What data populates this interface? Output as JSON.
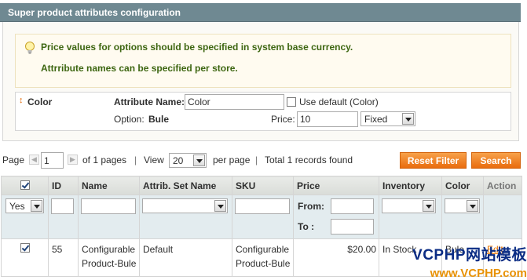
{
  "section": {
    "title": "Super product attributes configuration"
  },
  "notice": {
    "line1": "Price values for options should be specified in system base currency.",
    "line2": "Attrribute names can be specified per store."
  },
  "attribute": {
    "title": "Color",
    "name_label": "Attribute Name:",
    "name_value": "Color",
    "use_default_label": "Use default (Color)",
    "use_default_checked": false,
    "option_label": "Option:",
    "option_value": "Bule",
    "price_label": "Price:",
    "price_value": "10",
    "price_type": "Fixed"
  },
  "pager": {
    "page_label": "Page",
    "page_value": "1",
    "of_pages": "of 1 pages",
    "view_label": "View",
    "per_page_value": "20",
    "per_page_label": "per page",
    "records": "Total 1 records found",
    "reset_filter": "Reset Filter",
    "search": "Search"
  },
  "grid": {
    "headings": [
      "",
      "ID",
      "Name",
      "Attrib. Set Name",
      "SKU",
      "Price",
      "Inventory",
      "Color",
      "Action"
    ],
    "filter": {
      "selected": "Yes",
      "from_label": "From:",
      "to_label": "To :"
    },
    "rows": [
      {
        "checked": true,
        "id": "55",
        "name": "Configurable Product-Bule",
        "set": "Default",
        "sku": "Configurable Product-Bule",
        "price": "$20.00",
        "inventory": "In Stock",
        "color": "Bule",
        "action": "Edit"
      }
    ]
  },
  "watermark": {
    "line1": "VCPHP网站模板",
    "line2": "www.VCPHP.com"
  },
  "colors": {
    "header_bg": "#6f8992",
    "notice_text": "#3d6611",
    "button": "#e96c0e",
    "filter_bg": "#e3ecef"
  }
}
